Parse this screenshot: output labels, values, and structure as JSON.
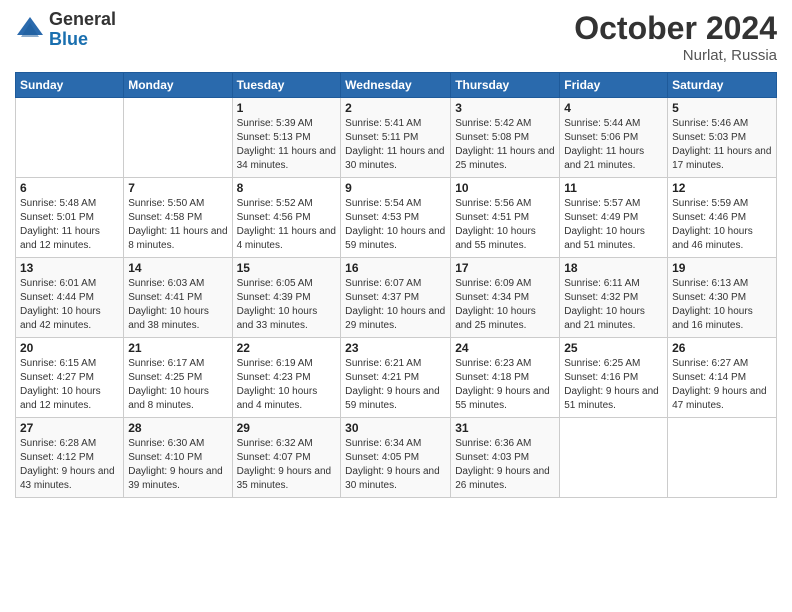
{
  "logo": {
    "general": "General",
    "blue": "Blue"
  },
  "title": "October 2024",
  "location": "Nurlat, Russia",
  "days_of_week": [
    "Sunday",
    "Monday",
    "Tuesday",
    "Wednesday",
    "Thursday",
    "Friday",
    "Saturday"
  ],
  "weeks": [
    [
      {
        "day": "",
        "info": ""
      },
      {
        "day": "",
        "info": ""
      },
      {
        "day": "1",
        "info": "Sunrise: 5:39 AM\nSunset: 5:13 PM\nDaylight: 11 hours and 34 minutes."
      },
      {
        "day": "2",
        "info": "Sunrise: 5:41 AM\nSunset: 5:11 PM\nDaylight: 11 hours and 30 minutes."
      },
      {
        "day": "3",
        "info": "Sunrise: 5:42 AM\nSunset: 5:08 PM\nDaylight: 11 hours and 25 minutes."
      },
      {
        "day": "4",
        "info": "Sunrise: 5:44 AM\nSunset: 5:06 PM\nDaylight: 11 hours and 21 minutes."
      },
      {
        "day": "5",
        "info": "Sunrise: 5:46 AM\nSunset: 5:03 PM\nDaylight: 11 hours and 17 minutes."
      }
    ],
    [
      {
        "day": "6",
        "info": "Sunrise: 5:48 AM\nSunset: 5:01 PM\nDaylight: 11 hours and 12 minutes."
      },
      {
        "day": "7",
        "info": "Sunrise: 5:50 AM\nSunset: 4:58 PM\nDaylight: 11 hours and 8 minutes."
      },
      {
        "day": "8",
        "info": "Sunrise: 5:52 AM\nSunset: 4:56 PM\nDaylight: 11 hours and 4 minutes."
      },
      {
        "day": "9",
        "info": "Sunrise: 5:54 AM\nSunset: 4:53 PM\nDaylight: 10 hours and 59 minutes."
      },
      {
        "day": "10",
        "info": "Sunrise: 5:56 AM\nSunset: 4:51 PM\nDaylight: 10 hours and 55 minutes."
      },
      {
        "day": "11",
        "info": "Sunrise: 5:57 AM\nSunset: 4:49 PM\nDaylight: 10 hours and 51 minutes."
      },
      {
        "day": "12",
        "info": "Sunrise: 5:59 AM\nSunset: 4:46 PM\nDaylight: 10 hours and 46 minutes."
      }
    ],
    [
      {
        "day": "13",
        "info": "Sunrise: 6:01 AM\nSunset: 4:44 PM\nDaylight: 10 hours and 42 minutes."
      },
      {
        "day": "14",
        "info": "Sunrise: 6:03 AM\nSunset: 4:41 PM\nDaylight: 10 hours and 38 minutes."
      },
      {
        "day": "15",
        "info": "Sunrise: 6:05 AM\nSunset: 4:39 PM\nDaylight: 10 hours and 33 minutes."
      },
      {
        "day": "16",
        "info": "Sunrise: 6:07 AM\nSunset: 4:37 PM\nDaylight: 10 hours and 29 minutes."
      },
      {
        "day": "17",
        "info": "Sunrise: 6:09 AM\nSunset: 4:34 PM\nDaylight: 10 hours and 25 minutes."
      },
      {
        "day": "18",
        "info": "Sunrise: 6:11 AM\nSunset: 4:32 PM\nDaylight: 10 hours and 21 minutes."
      },
      {
        "day": "19",
        "info": "Sunrise: 6:13 AM\nSunset: 4:30 PM\nDaylight: 10 hours and 16 minutes."
      }
    ],
    [
      {
        "day": "20",
        "info": "Sunrise: 6:15 AM\nSunset: 4:27 PM\nDaylight: 10 hours and 12 minutes."
      },
      {
        "day": "21",
        "info": "Sunrise: 6:17 AM\nSunset: 4:25 PM\nDaylight: 10 hours and 8 minutes."
      },
      {
        "day": "22",
        "info": "Sunrise: 6:19 AM\nSunset: 4:23 PM\nDaylight: 10 hours and 4 minutes."
      },
      {
        "day": "23",
        "info": "Sunrise: 6:21 AM\nSunset: 4:21 PM\nDaylight: 9 hours and 59 minutes."
      },
      {
        "day": "24",
        "info": "Sunrise: 6:23 AM\nSunset: 4:18 PM\nDaylight: 9 hours and 55 minutes."
      },
      {
        "day": "25",
        "info": "Sunrise: 6:25 AM\nSunset: 4:16 PM\nDaylight: 9 hours and 51 minutes."
      },
      {
        "day": "26",
        "info": "Sunrise: 6:27 AM\nSunset: 4:14 PM\nDaylight: 9 hours and 47 minutes."
      }
    ],
    [
      {
        "day": "27",
        "info": "Sunrise: 6:28 AM\nSunset: 4:12 PM\nDaylight: 9 hours and 43 minutes."
      },
      {
        "day": "28",
        "info": "Sunrise: 6:30 AM\nSunset: 4:10 PM\nDaylight: 9 hours and 39 minutes."
      },
      {
        "day": "29",
        "info": "Sunrise: 6:32 AM\nSunset: 4:07 PM\nDaylight: 9 hours and 35 minutes."
      },
      {
        "day": "30",
        "info": "Sunrise: 6:34 AM\nSunset: 4:05 PM\nDaylight: 9 hours and 30 minutes."
      },
      {
        "day": "31",
        "info": "Sunrise: 6:36 AM\nSunset: 4:03 PM\nDaylight: 9 hours and 26 minutes."
      },
      {
        "day": "",
        "info": ""
      },
      {
        "day": "",
        "info": ""
      }
    ]
  ]
}
